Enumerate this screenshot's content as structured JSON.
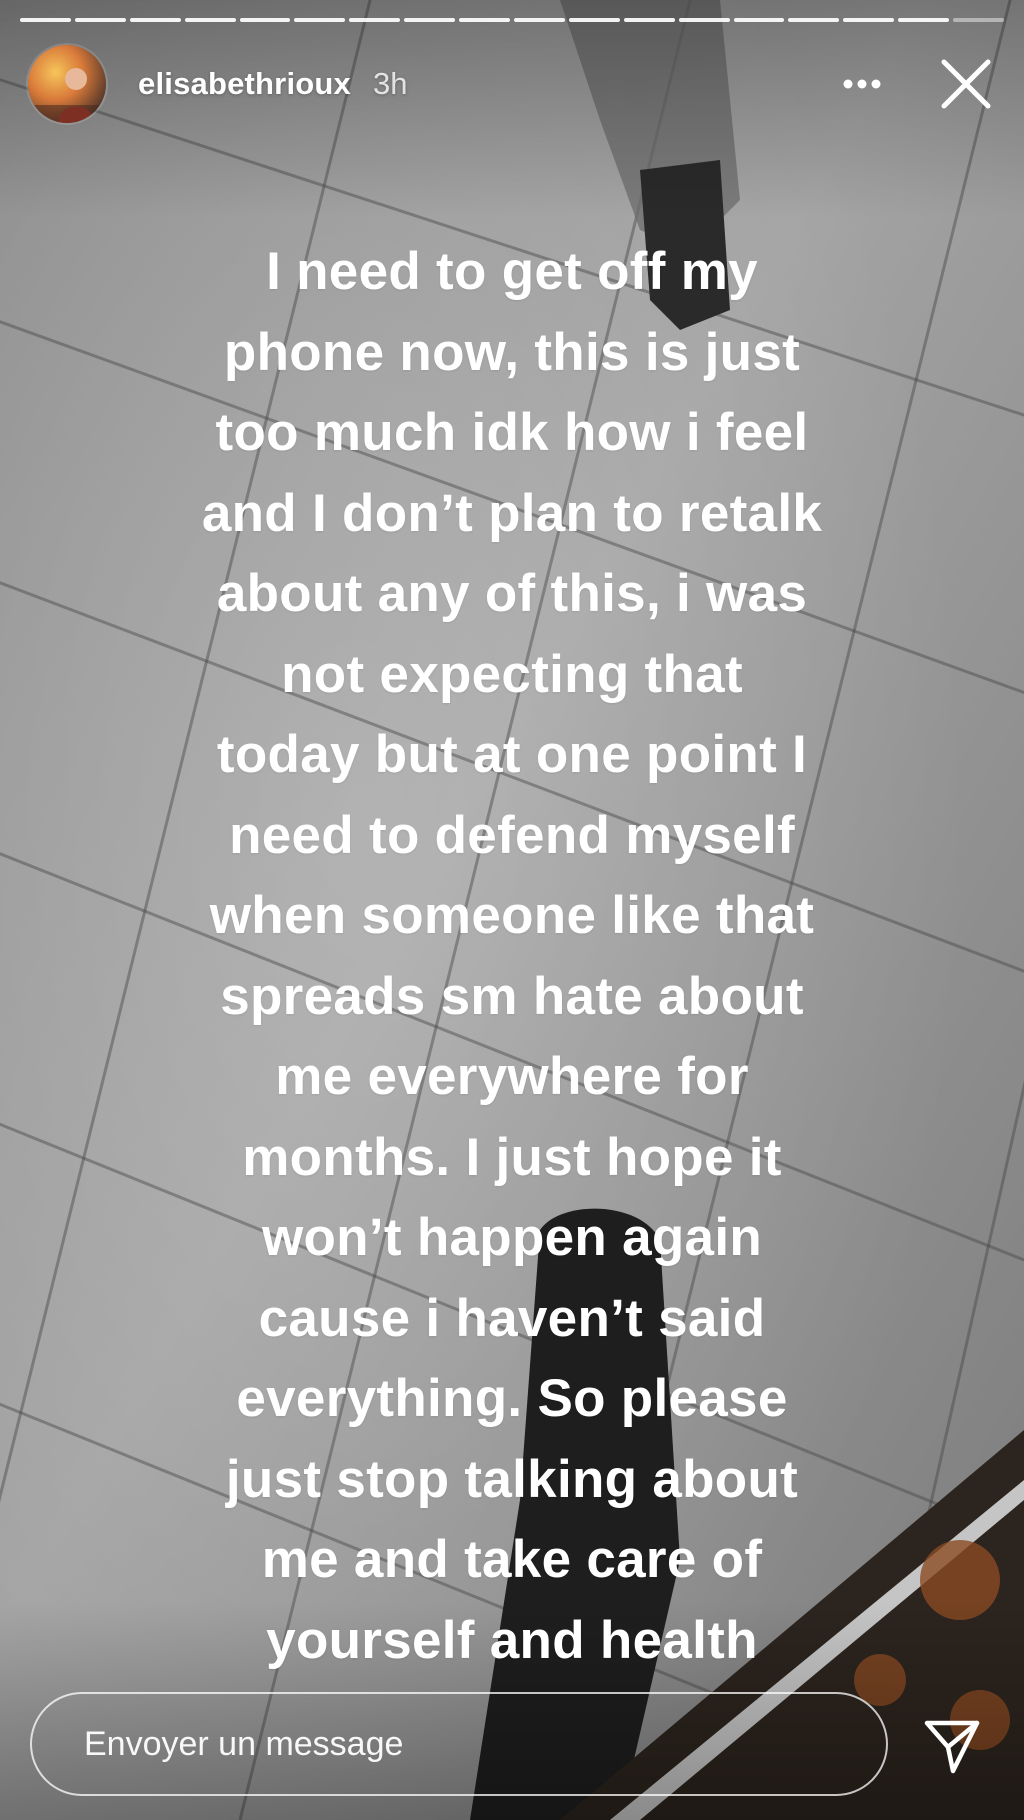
{
  "story": {
    "progress_segments": 18,
    "progress_completed": 17,
    "username": "elisabethrioux",
    "time_ago": "3h",
    "text_lines": [
      "I need to get off my",
      "phone now, this is just",
      "too much idk how i feel",
      "and I don’t plan to retalk",
      "about any of this, i was",
      "not expecting that",
      "today but at one point I",
      "need to defend myself",
      "when someone like that",
      "spreads sm hate about",
      "me everywhere for",
      "months. I just hope it",
      "won’t happen again",
      "cause i haven’t said",
      "everything. So please",
      "just stop talking about",
      "me and take care of",
      "yourself and health"
    ]
  },
  "header": {
    "avatar_icon": "profile-avatar",
    "more_icon": "more-horizontal-icon",
    "close_icon": "close-icon"
  },
  "footer": {
    "message_placeholder": "Envoyer un message",
    "send_icon": "send-icon"
  },
  "colors": {
    "text": "#ffffff",
    "background": "#8a8a8a"
  }
}
